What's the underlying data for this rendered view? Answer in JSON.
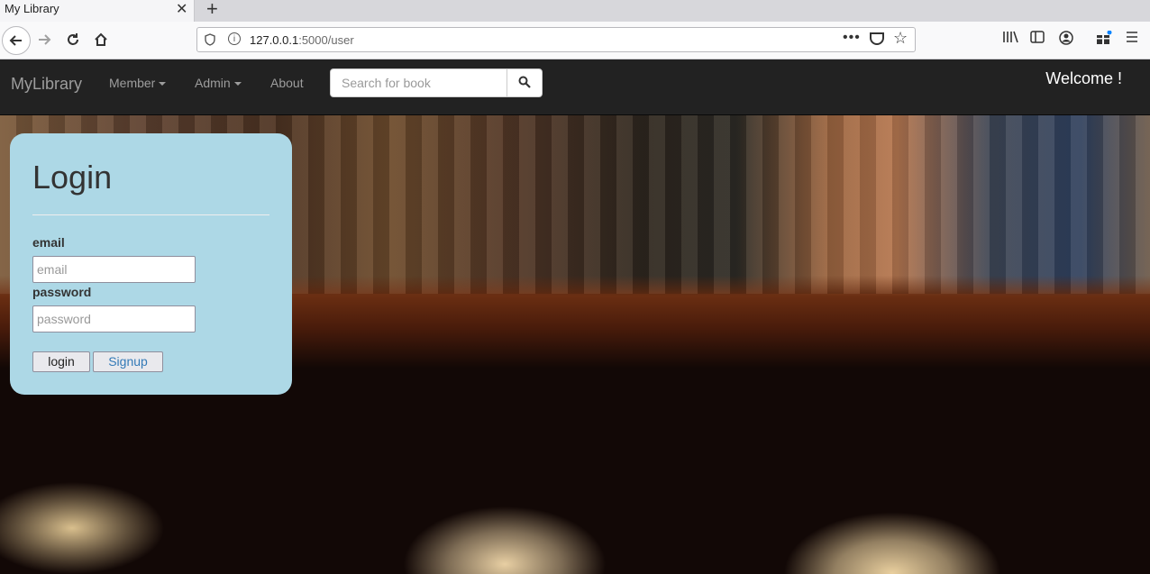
{
  "browser": {
    "tab_title": "My Library",
    "tab_close": "✕",
    "new_tab": "+",
    "url_host": "127.0.0.1",
    "url_path": ":5000/user",
    "url_more": "•••"
  },
  "nav": {
    "brand": "MyLibrary",
    "member": "Member",
    "admin": "Admin",
    "about": "About",
    "search_placeholder": "Search for book",
    "welcome": "Welcome !"
  },
  "login": {
    "title": "Login",
    "email_label": "email",
    "email_placeholder": "email",
    "password_label": "password",
    "password_placeholder": "password",
    "login_button": "login",
    "signup_button": "Signup"
  },
  "colors": {
    "navbar_bg": "#222222",
    "login_bg": "#add8e6",
    "link_blue": "#337ab7"
  }
}
